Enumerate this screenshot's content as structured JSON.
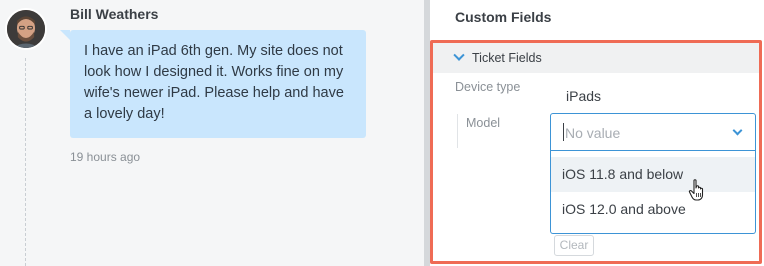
{
  "conversation": {
    "author": "Bill Weathers",
    "message": "I have an iPad 6th gen. My site does not look how I designed it. Works fine on my wife's newer iPad. Please help and have a lovely day!",
    "timestamp": "19 hours ago"
  },
  "custom_fields": {
    "title": "Custom Fields",
    "section": {
      "label": "Ticket Fields",
      "expanded": true
    },
    "device_type": {
      "label": "Device type",
      "value": "iPads"
    },
    "model": {
      "label": "Model",
      "placeholder": "No value",
      "options": [
        "iOS 11.8 and below",
        "iOS 12.0 and above"
      ],
      "hovered_option_index": 0
    },
    "clear_label": "Clear"
  },
  "colors": {
    "highlight_border": "#ef6b55",
    "accent_blue": "#3d94d6",
    "bubble_bg": "#c9e6fd"
  },
  "icons": [
    "avatar",
    "chevron-down-icon",
    "pointer-hand-cursor-icon"
  ]
}
